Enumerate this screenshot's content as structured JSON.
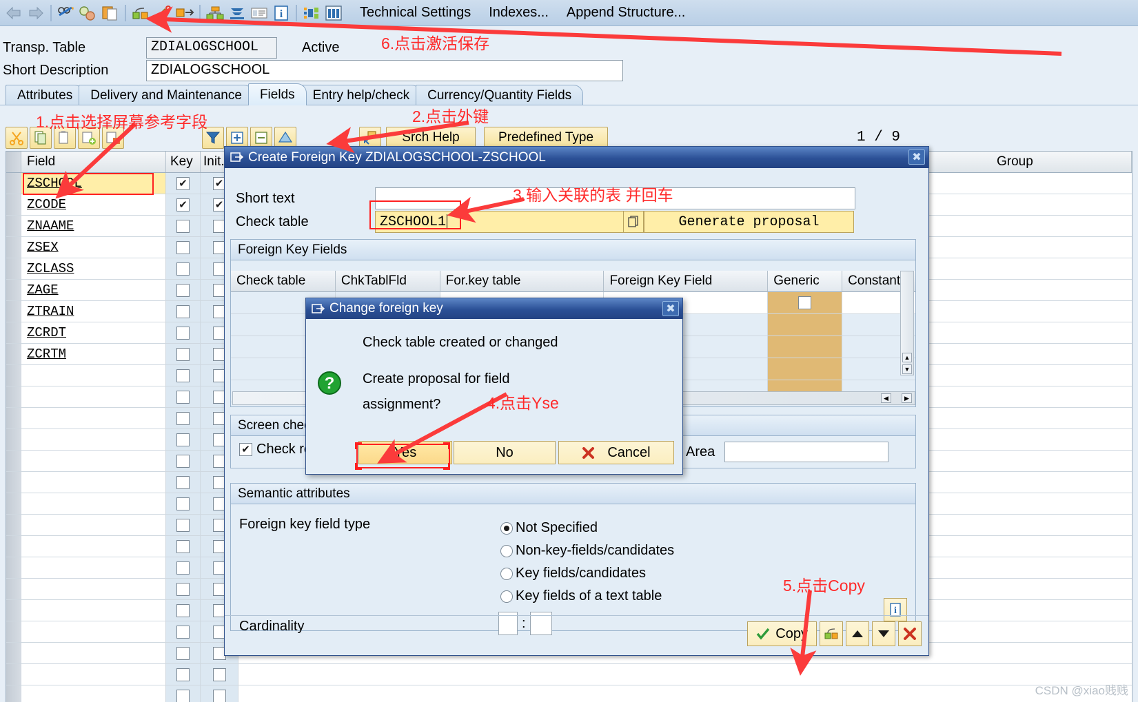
{
  "toolbar": {
    "icons": [
      "back-arrow-icon",
      "forward-arrow-icon",
      "display-change-icon",
      "check-icon",
      "copy-paste-icon",
      "object-directory-icon",
      "wand-activate-icon",
      "transport-icon",
      "hierarchy-icon",
      "print-preview-icon",
      "list-icon",
      "info-icon",
      "structure-display-icon",
      "table-columns-icon"
    ],
    "menu_items": [
      "Technical Settings",
      "Indexes...",
      "Append Structure..."
    ]
  },
  "header": {
    "table_label": "Transp. Table",
    "table_value": "ZDIALOGSCHOOL",
    "status": "Active",
    "desc_label": "Short Description",
    "desc_value": "ZDIALOGSCHOOL"
  },
  "tabs": [
    {
      "label": "Attributes",
      "active": false
    },
    {
      "label": "Delivery and Maintenance",
      "active": false
    },
    {
      "label": "Fields",
      "active": true
    },
    {
      "label": "Entry help/check",
      "active": false
    },
    {
      "label": "Currency/Quantity Fields",
      "active": false
    }
  ],
  "field_toolbar": {
    "icons": [
      "cut-icon",
      "copy-icon",
      "paste-icon",
      "insert-row-icon",
      "delete-row-icon",
      "filter-icon",
      "append-row-icon",
      "delete-entry-icon",
      "expand-icon",
      "foreign-key-icon"
    ],
    "srch_help_label": "Srch Help",
    "predefined_type_label": "Predefined Type",
    "page_indicator": "1 / 9"
  },
  "fields_grid": {
    "columns": [
      "Field",
      "Key",
      "Init...",
      "Group"
    ],
    "rows": [
      {
        "field": "ZSCHOOL",
        "key": true,
        "init": true,
        "selected": true
      },
      {
        "field": "ZCODE",
        "key": true,
        "init": true,
        "selected": false
      },
      {
        "field": "ZNAAME",
        "key": false,
        "init": false,
        "selected": false
      },
      {
        "field": "ZSEX",
        "key": false,
        "init": false,
        "selected": false
      },
      {
        "field": "ZCLASS",
        "key": false,
        "init": false,
        "selected": false
      },
      {
        "field": "ZAGE",
        "key": false,
        "init": false,
        "selected": false
      },
      {
        "field": "ZTRAIN",
        "key": false,
        "init": false,
        "selected": false
      },
      {
        "field": "ZCRDT",
        "key": false,
        "init": false,
        "selected": false
      },
      {
        "field": "ZCRTM",
        "key": false,
        "init": false,
        "selected": false
      },
      {
        "field": "",
        "key": false,
        "init": false,
        "selected": false
      },
      {
        "field": "",
        "key": false,
        "init": false,
        "selected": false
      },
      {
        "field": "",
        "key": false,
        "init": false,
        "selected": false
      },
      {
        "field": "",
        "key": false,
        "init": false,
        "selected": false
      },
      {
        "field": "",
        "key": false,
        "init": false,
        "selected": false
      },
      {
        "field": "",
        "key": false,
        "init": false,
        "selected": false
      },
      {
        "field": "",
        "key": false,
        "init": false,
        "selected": false
      },
      {
        "field": "",
        "key": false,
        "init": false,
        "selected": false
      },
      {
        "field": "",
        "key": false,
        "init": false,
        "selected": false
      },
      {
        "field": "",
        "key": false,
        "init": false,
        "selected": false
      },
      {
        "field": "",
        "key": false,
        "init": false,
        "selected": false
      },
      {
        "field": "",
        "key": false,
        "init": false,
        "selected": false
      },
      {
        "field": "",
        "key": false,
        "init": false,
        "selected": false
      },
      {
        "field": "",
        "key": false,
        "init": false,
        "selected": false
      },
      {
        "field": "",
        "key": false,
        "init": false,
        "selected": false
      },
      {
        "field": "",
        "key": false,
        "init": false,
        "selected": false
      }
    ]
  },
  "fk_dialog": {
    "title": "Create Foreign Key ZDIALOGSCHOOL-ZSCHOOL",
    "short_text_label": "Short text",
    "short_text_value": "",
    "check_table_label": "Check table",
    "check_table_value": "ZSCHOOL1",
    "generate_proposal_label": "Generate proposal",
    "fk_fields_group": "Foreign Key Fields",
    "fk_columns": [
      "Check table",
      "ChkTablFld",
      "For.key table",
      "Foreign Key Field",
      "Generic",
      "Constant"
    ],
    "screen_check_group": "Screen check",
    "check_required_label": "Check req",
    "area_label": "Area",
    "area_value": "",
    "semantic_group": "Semantic attributes",
    "fk_field_type_label": "Foreign key field type",
    "fk_field_type_options": [
      {
        "label": "Not Specified",
        "selected": true
      },
      {
        "label": "Non-key-fields/candidates",
        "selected": false
      },
      {
        "label": "Key fields/candidates",
        "selected": false
      },
      {
        "label": "Key fields of a text table",
        "selected": false
      }
    ],
    "cardinality_label": "Cardinality",
    "cardinality_left": "",
    "cardinality_right": "",
    "copy_button_label": "Copy",
    "footer_icons": [
      "check-other-keys-icon",
      "previous-arrow-icon",
      "next-arrow-icon",
      "cancel-x-icon"
    ],
    "info_icon": "info-icon"
  },
  "confirm_dialog": {
    "title": "Change foreign key",
    "line1": "Check table created or changed",
    "line2a": "Create proposal for field",
    "line2b": "assignment?",
    "icon": "question-icon",
    "buttons": [
      {
        "label": "Yes",
        "highlighted": true,
        "icon": ""
      },
      {
        "label": "No",
        "highlighted": false,
        "icon": ""
      },
      {
        "label": "Cancel",
        "highlighted": false,
        "icon": "cancel-x-icon"
      }
    ]
  },
  "annotations": [
    {
      "id": "a1",
      "text": "1.点击选择屏幕参考字段"
    },
    {
      "id": "a2",
      "text": "2.点击外键"
    },
    {
      "id": "a3",
      "text": "3.输入关联的表 并回车"
    },
    {
      "id": "a4",
      "text": "4.点击Yse"
    },
    {
      "id": "a5",
      "text": "5.点击Copy"
    },
    {
      "id": "a6",
      "text": "6.点击激活保存"
    }
  ],
  "watermark": "CSDN @xiao贱贱",
  "colors": {
    "accent_blue": "#2b5096",
    "annotation_red": "#ff2a2a",
    "highlight_yellow": "#ffeea8",
    "generic_column": "#e0b974"
  }
}
